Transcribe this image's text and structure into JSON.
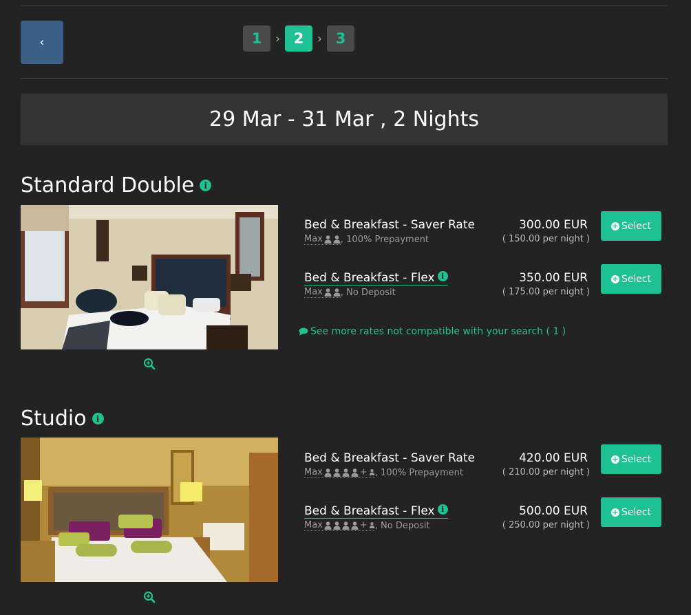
{
  "nav": {
    "back_symbol": "‹",
    "steps": [
      {
        "label": "1",
        "active": false
      },
      {
        "label": "2",
        "active": true
      },
      {
        "label": "3",
        "active": false
      }
    ],
    "step_separator": "›"
  },
  "search": {
    "dates": "29 Mar - 31 Mar , 2 Nights"
  },
  "colors": {
    "accent": "#1ec193",
    "back_button": "#3b5f86",
    "background": "#232323"
  },
  "rooms": [
    {
      "name": "Standard Double",
      "rates": [
        {
          "name": "Bed & Breakfast - Saver Rate",
          "max_label": "Max",
          "adults": 2,
          "children": 0,
          "condition": ", 100% Prepayment",
          "price": "300.00 EUR",
          "per_night": "( 150.00 per night )",
          "button": "Select",
          "has_info": false
        },
        {
          "name": "Bed & Breakfast - Flex",
          "max_label": "Max",
          "adults": 2,
          "children": 0,
          "condition": ", No Deposit",
          "price": "350.00 EUR",
          "per_night": "( 175.00 per night )",
          "button": "Select",
          "has_info": true
        }
      ],
      "more_rates": "See more rates not compatible with your search ( 1 )"
    },
    {
      "name": "Studio",
      "rates": [
        {
          "name": "Bed & Breakfast - Saver Rate",
          "max_label": "Max",
          "adults": 4,
          "children": 1,
          "condition": ", 100% Prepayment",
          "price": "420.00 EUR",
          "per_night": "( 210.00 per night )",
          "button": "Select",
          "has_info": false
        },
        {
          "name": "Bed & Breakfast - Flex",
          "max_label": "Max",
          "adults": 4,
          "children": 1,
          "condition": ", No Deposit",
          "price": "500.00 EUR",
          "per_night": "( 250.00 per night )",
          "button": "Select",
          "has_info": true
        }
      ]
    }
  ],
  "icons": {
    "info": "info-circle-icon",
    "zoom": "zoom-in-icon",
    "comment": "comment-icon",
    "plus": "plus-circle-icon",
    "person": "user-icon"
  }
}
